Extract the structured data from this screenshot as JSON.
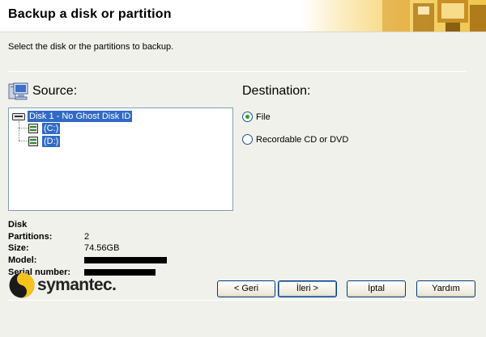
{
  "header": {
    "title": "Backup a disk or partition"
  },
  "instruction": "Select the disk or the partitions to backup.",
  "source": {
    "title": "Source:",
    "icon": "computer-icon",
    "tree": [
      {
        "label": "Disk 1 - No Ghost Disk ID",
        "icon": "disk-drive-icon",
        "level": 0
      },
      {
        "label": "(C:)",
        "icon": "partition-icon",
        "level": 1
      },
      {
        "label": "(D:)",
        "icon": "partition-icon",
        "level": 1
      }
    ]
  },
  "destination": {
    "title": "Destination:",
    "options": [
      {
        "label": "File",
        "selected": true
      },
      {
        "label": "Recordable CD or DVD",
        "selected": false
      }
    ]
  },
  "disk_info": {
    "heading": "Disk",
    "partitions_label": "Partitions:",
    "partitions_value": "2",
    "size_label": "Size:",
    "size_value": "74.56GB",
    "model_label": "Model:",
    "serial_label": "Serial number:"
  },
  "footer": {
    "logo_text": "symantec.",
    "buttons": {
      "back": "< Geri",
      "next": "İleri >",
      "cancel": "İptal",
      "help": "Yardım"
    }
  },
  "colors": {
    "selection": "#316ac5",
    "panel_bg": "#f1f1ec",
    "header_accent": "#efc54a",
    "radio_dot": "#21a121"
  }
}
